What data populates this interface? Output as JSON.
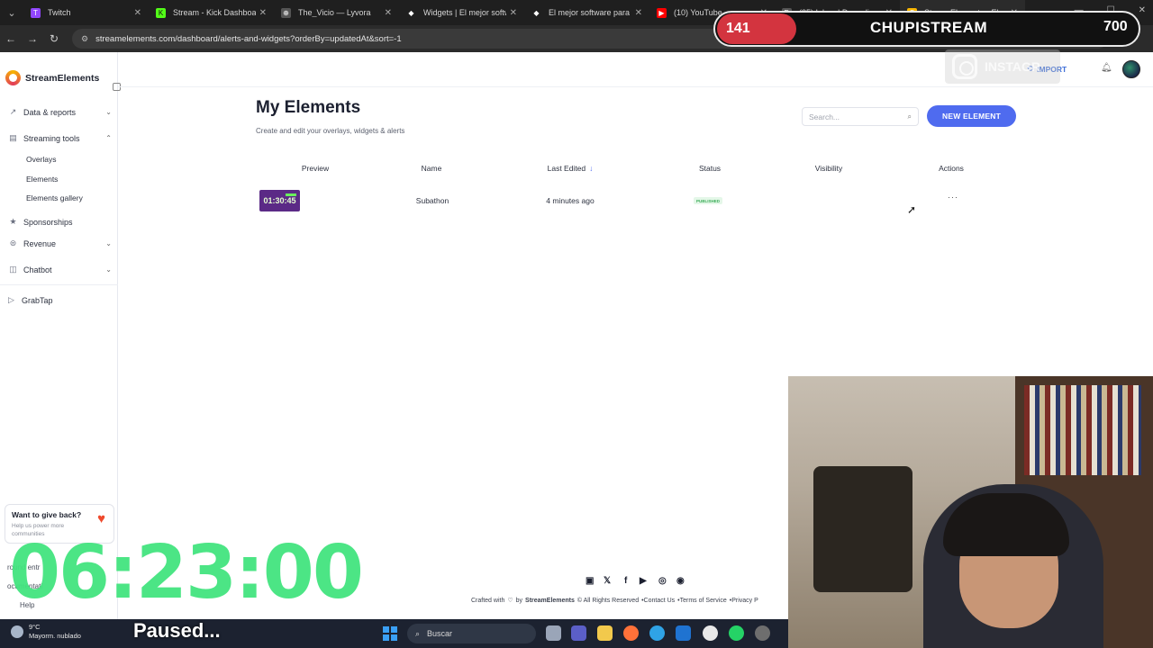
{
  "browser": {
    "tabs": [
      {
        "label": "Twitch",
        "color": "#9146ff",
        "glyph": "T"
      },
      {
        "label": "Stream - Kick Dashboard",
        "color": "#53fc18",
        "glyph": "K"
      },
      {
        "label": "The_Vicio — Lyvora",
        "color": "#666666",
        "glyph": "⊕"
      },
      {
        "label": "Widgets | El mejor softwa",
        "color": "#1f1f1f",
        "glyph": "◆"
      },
      {
        "label": "El mejor software para po",
        "color": "#1f1f1f",
        "glyph": "◆"
      },
      {
        "label": "(10) YouTube",
        "color": "#ff0000",
        "glyph": "▶"
      },
      {
        "label": "(35) Inbox | Donoclip",
        "color": "#555555",
        "glyph": "D"
      },
      {
        "label": "StreamElements - Elemen",
        "color": "#f7b500",
        "glyph": "S"
      }
    ],
    "url": "streamelements.com/dashboard/alerts-and-widgets?orderBy=updatedAt&sort=-1"
  },
  "sidebar": {
    "brand": "StreamElements",
    "items": [
      {
        "label": "Data & reports",
        "icon": "chart-line-icon"
      },
      {
        "label": "Streaming tools",
        "icon": "tools-icon"
      },
      {
        "label": "Sponsorships",
        "icon": "star-icon"
      },
      {
        "label": "Revenue",
        "icon": "dollar-icon"
      },
      {
        "label": "Chatbot",
        "icon": "chat-icon"
      },
      {
        "label": "GrabTap",
        "icon": "play-icon"
      }
    ],
    "sub_items": [
      "Overlays",
      "Elements",
      "Elements gallery"
    ],
    "giveback": {
      "title": "Want to give back?",
      "subtitle": "Help us power more communities"
    },
    "bottom_items": [
      "round entr",
      "ocumentati",
      "Help"
    ]
  },
  "topbar": {
    "import_label": "IMPORT"
  },
  "main": {
    "title": "My Elements",
    "subtitle": "Create and edit your overlays, widgets & alerts",
    "search_placeholder": "Search...",
    "new_element_label": "NEW ELEMENT",
    "columns": [
      "Preview",
      "Name",
      "Last Edited",
      "Status",
      "Visibility",
      "Actions"
    ],
    "rows": [
      {
        "preview_text": "01:30:45",
        "name": "Subathon",
        "last_edited": "4 minutes ago",
        "status": "PUBLISHED",
        "visibility": "",
        "actions": "···"
      }
    ]
  },
  "footer": {
    "crafted": "Crafted with",
    "by": "by",
    "brand": "StreamElements",
    "rights": "© All Rights Reserved",
    "contact": "•Contact Us",
    "terms": "•Terms of Service",
    "privacy": "•Privacy P"
  },
  "overlay": {
    "count": "141",
    "name": "CHUPISTREAM",
    "points": "700",
    "insta": "INSTAGR",
    "timer": "06:23:00",
    "paused": "Paused..."
  },
  "taskbar": {
    "weather_temp": "9°C",
    "weather_desc": "Mayorm. nublado",
    "search_label": "Buscar"
  },
  "colors": {
    "accent": "#4f6bef",
    "published_green": "#3fae5b",
    "timer_green": "#43e47f",
    "overlay_red": "#d3343f"
  }
}
